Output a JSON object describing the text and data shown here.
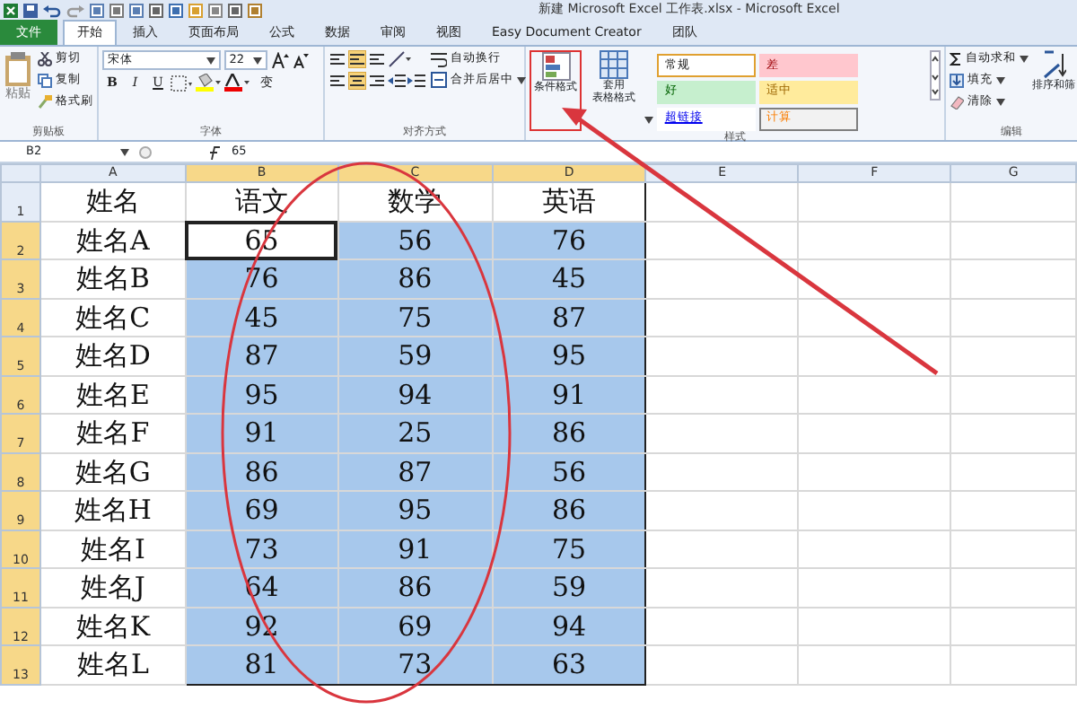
{
  "window": {
    "title": "新建 Microsoft Excel 工作表.xlsx - Microsoft Excel"
  },
  "tabs": [
    {
      "label": "文件",
      "kind": "file",
      "selected": false
    },
    {
      "label": "开始",
      "kind": "tab",
      "selected": true
    },
    {
      "label": "插入",
      "kind": "tab",
      "selected": false
    },
    {
      "label": "页面布局",
      "kind": "tab",
      "selected": false
    },
    {
      "label": "公式",
      "kind": "tab",
      "selected": false
    },
    {
      "label": "数据",
      "kind": "tab",
      "selected": false
    },
    {
      "label": "审阅",
      "kind": "tab",
      "selected": false
    },
    {
      "label": "视图",
      "kind": "tab",
      "selected": false
    },
    {
      "label": "Easy Document Creator",
      "kind": "tab",
      "selected": false
    },
    {
      "label": "团队",
      "kind": "tab",
      "selected": false
    }
  ],
  "ribbon": {
    "clipboard": {
      "paste": "粘贴",
      "cut": "剪切",
      "copy": "复制",
      "format_painter": "格式刷",
      "label": "剪贴板"
    },
    "font": {
      "font_name": "宋体",
      "font_size": "22",
      "format_buttons": [
        "B",
        "I",
        "U"
      ],
      "phonetic": "变",
      "label": "字体"
    },
    "alignment": {
      "wrap_text": "自动换行",
      "merge_center": "合并后居中",
      "label": "对齐方式"
    },
    "styles": {
      "conditional_formatting": "条件格式",
      "table_format_1": "套用",
      "table_format_2": "表格格式",
      "label": "样式",
      "cell_styles": [
        {
          "label": "常规",
          "kind": "normal"
        },
        {
          "label": "差",
          "kind": "bad"
        },
        {
          "label": "好",
          "kind": "good"
        },
        {
          "label": "适中",
          "kind": "neutral"
        },
        {
          "label": "超链接",
          "kind": "link"
        },
        {
          "label": "计算",
          "kind": "calc"
        }
      ]
    },
    "editing": {
      "autosum": "自动求和",
      "fill": "填充",
      "clear": "清除",
      "sort_filter": "排序和筛",
      "label": "编辑"
    }
  },
  "formula_bar": {
    "name_box": "B2",
    "formula": "65"
  },
  "columns": [
    {
      "label": "A",
      "selected": false
    },
    {
      "label": "B",
      "selected": true
    },
    {
      "label": "C",
      "selected": true
    },
    {
      "label": "D",
      "selected": true
    },
    {
      "label": "E",
      "selected": false
    },
    {
      "label": "F",
      "selected": false
    },
    {
      "label": "G",
      "selected": false
    }
  ],
  "rows": [
    {
      "number": "1",
      "selected": false,
      "cells": [
        {
          "text": "姓名",
          "active": false
        },
        {
          "text": "语文",
          "active": false
        },
        {
          "text": "数学",
          "active": false
        },
        {
          "text": "英语",
          "active": false
        }
      ]
    },
    {
      "number": "2",
      "selected": true,
      "cells": [
        {
          "text": "姓名A",
          "active": false
        },
        {
          "text": "65",
          "active": true
        },
        {
          "text": "56",
          "active": false
        },
        {
          "text": "76",
          "active": false
        }
      ]
    },
    {
      "number": "3",
      "selected": true,
      "cells": [
        {
          "text": "姓名B",
          "active": false
        },
        {
          "text": "76",
          "active": false
        },
        {
          "text": "86",
          "active": false
        },
        {
          "text": "45",
          "active": false
        }
      ]
    },
    {
      "number": "4",
      "selected": true,
      "cells": [
        {
          "text": "姓名C",
          "active": false
        },
        {
          "text": "45",
          "active": false
        },
        {
          "text": "75",
          "active": false
        },
        {
          "text": "87",
          "active": false
        }
      ]
    },
    {
      "number": "5",
      "selected": true,
      "cells": [
        {
          "text": "姓名D",
          "active": false
        },
        {
          "text": "87",
          "active": false
        },
        {
          "text": "59",
          "active": false
        },
        {
          "text": "95",
          "active": false
        }
      ]
    },
    {
      "number": "6",
      "selected": true,
      "cells": [
        {
          "text": "姓名E",
          "active": false
        },
        {
          "text": "95",
          "active": false
        },
        {
          "text": "94",
          "active": false
        },
        {
          "text": "91",
          "active": false
        }
      ]
    },
    {
      "number": "7",
      "selected": true,
      "cells": [
        {
          "text": "姓名F",
          "active": false
        },
        {
          "text": "91",
          "active": false
        },
        {
          "text": "25",
          "active": false
        },
        {
          "text": "86",
          "active": false
        }
      ]
    },
    {
      "number": "8",
      "selected": true,
      "cells": [
        {
          "text": "姓名G",
          "active": false
        },
        {
          "text": "86",
          "active": false
        },
        {
          "text": "87",
          "active": false
        },
        {
          "text": "56",
          "active": false
        }
      ]
    },
    {
      "number": "9",
      "selected": true,
      "cells": [
        {
          "text": "姓名H",
          "active": false
        },
        {
          "text": "69",
          "active": false
        },
        {
          "text": "95",
          "active": false
        },
        {
          "text": "86",
          "active": false
        }
      ]
    },
    {
      "number": "10",
      "selected": true,
      "cells": [
        {
          "text": "姓名I",
          "active": false
        },
        {
          "text": "73",
          "active": false
        },
        {
          "text": "91",
          "active": false
        },
        {
          "text": "75",
          "active": false
        }
      ]
    },
    {
      "number": "11",
      "selected": true,
      "cells": [
        {
          "text": "姓名J",
          "active": false
        },
        {
          "text": "64",
          "active": false
        },
        {
          "text": "86",
          "active": false
        },
        {
          "text": "59",
          "active": false
        }
      ]
    },
    {
      "number": "12",
      "selected": true,
      "cells": [
        {
          "text": "姓名K",
          "active": false
        },
        {
          "text": "92",
          "active": false
        },
        {
          "text": "69",
          "active": false
        },
        {
          "text": "94",
          "active": false
        }
      ]
    },
    {
      "number": "13",
      "selected": true,
      "cells": [
        {
          "text": "姓名L",
          "active": false
        },
        {
          "text": "81",
          "active": false
        },
        {
          "text": "73",
          "active": false
        },
        {
          "text": "63",
          "active": false
        }
      ]
    }
  ]
}
